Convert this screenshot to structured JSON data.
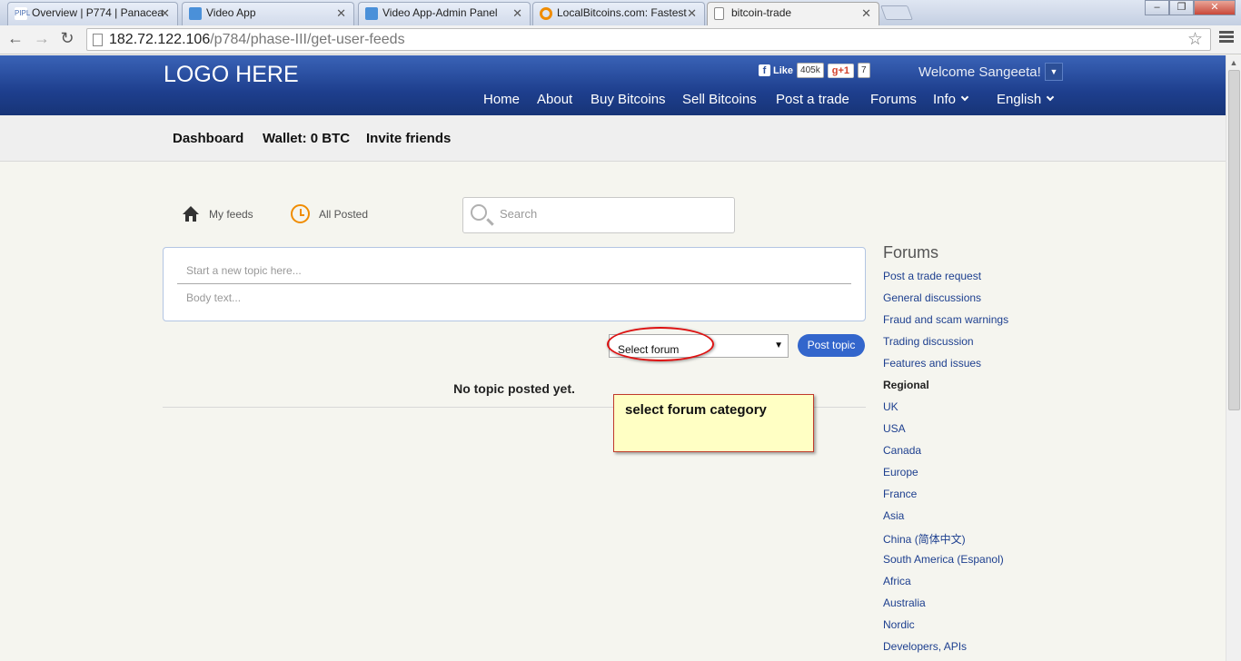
{
  "browser": {
    "tabs": [
      {
        "label": "Overview | P774 | Panacea",
        "icon_color": "#4a6fb3",
        "active": false
      },
      {
        "label": "Video App",
        "icon_color": "#4a90d9",
        "active": false
      },
      {
        "label": "Video App-Admin Panel",
        "icon_color": "#4a90d9",
        "active": false
      },
      {
        "label": "LocalBitcoins.com: Fastest",
        "icon_color": "#f08c00",
        "active": false
      },
      {
        "label": "bitcoin-trade",
        "icon_color": "#ffffff",
        "active": true
      }
    ],
    "url_host": "182.72.122.106",
    "url_path": "/p784/phase-III/get-user-feeds",
    "window_buttons": [
      "–",
      "❐",
      "✕"
    ]
  },
  "header": {
    "logo": "LOGO HERE",
    "fb_like": "Like",
    "fb_count": "405k",
    "gplus_label": "+1",
    "gplus_count": "7",
    "welcome": "Welcome Sangeeta!",
    "nav": [
      "Home",
      "About",
      "Buy Bitcoins",
      "Sell Bitcoins",
      "Post a trade",
      "Forums",
      "Info",
      "English"
    ]
  },
  "subnav": {
    "dashboard": "Dashboard",
    "wallet": "Wallet: 0 BTC",
    "invite": "Invite friends"
  },
  "feeds": {
    "my_feeds": "My feeds",
    "all_posted": "All Posted",
    "search_placeholder": "Search",
    "topic_placeholder": "Start a new topic here...",
    "body_placeholder": "Body text...",
    "select_forum": "Select forum",
    "post_button": "Post topic",
    "empty_message": "No topic posted yet.",
    "annotation": "select forum category"
  },
  "forums": {
    "title": "Forums",
    "links": [
      "Post a trade request",
      "General discussions",
      "Fraud and scam warnings",
      "Trading discussion",
      "Features and issues"
    ],
    "regional_heading": "Regional",
    "regional": [
      "UK",
      "USA",
      "Canada",
      "Europe",
      "France",
      "Asia",
      "China (简体中文)",
      "South America (Espanol)",
      "Africa",
      "Australia",
      "Nordic",
      "Developers, APIs"
    ]
  }
}
